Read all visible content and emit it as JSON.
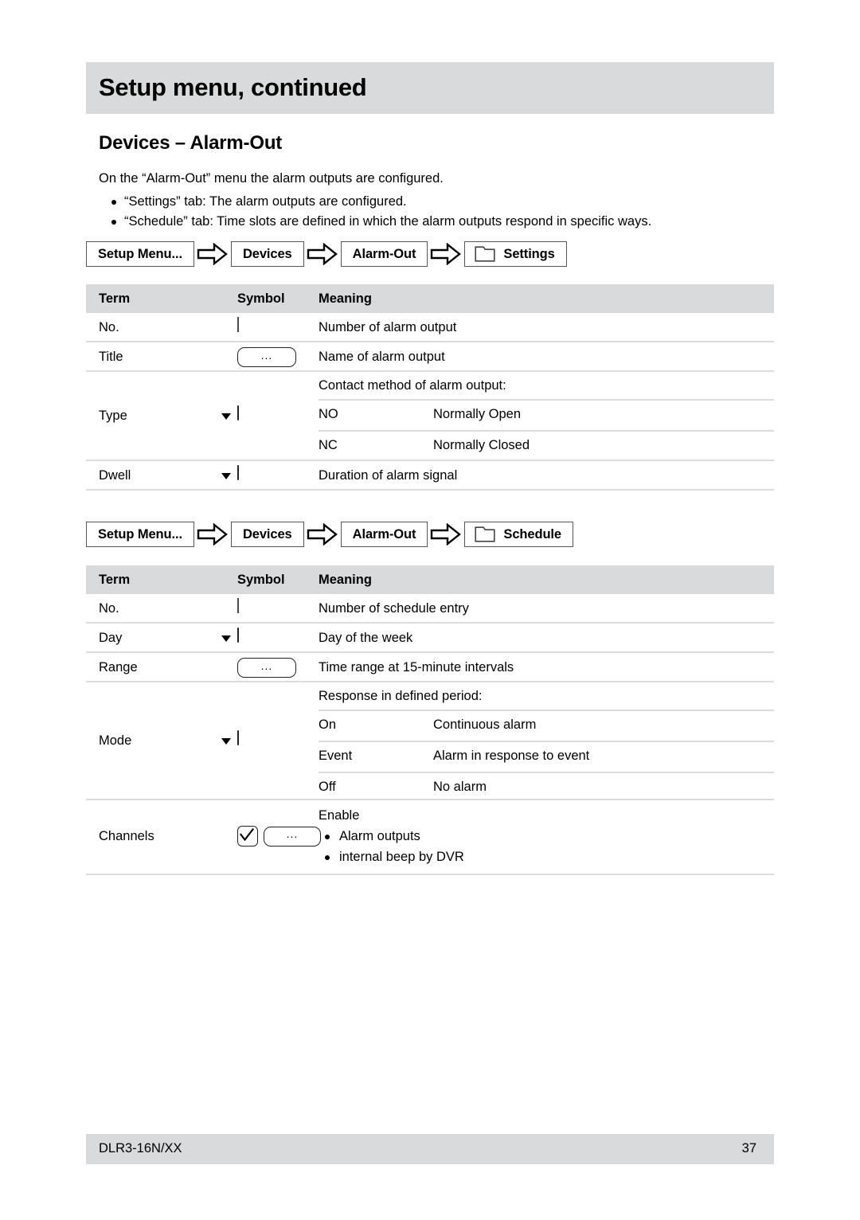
{
  "header": {
    "running_title": "Setup menu, continued"
  },
  "section": {
    "heading": "Devices – Alarm-Out",
    "intro": "On the “Alarm-Out” menu the alarm outputs are configured.",
    "bullets": [
      "“Settings” tab: The alarm outputs are configured.",
      "“Schedule” tab: Time slots are defined in which the alarm outputs respond in specific ways."
    ]
  },
  "breadcrumb_settings": {
    "crumbs": [
      "Setup Menu...",
      "Devices",
      "Alarm-Out",
      "Settings"
    ],
    "separator_icon": "right-block-arrow-icon",
    "tab_icon": "folder-tab-icon"
  },
  "breadcrumb_schedule": {
    "crumbs": [
      "Setup Menu...",
      "Devices",
      "Alarm-Out",
      "Schedule"
    ],
    "separator_icon": "right-block-arrow-icon",
    "tab_icon": "folder-tab-icon"
  },
  "table_settings": {
    "columns": [
      "Term",
      "Symbol",
      "Meaning"
    ],
    "rows": [
      {
        "term": "No.",
        "symbol": "text-input-box",
        "symbol_text": "",
        "meaning": "Number of alarm output"
      },
      {
        "term": "Title",
        "symbol": "ellipsis-button",
        "symbol_text": "...",
        "meaning": "Name of alarm output"
      },
      {
        "term": "Type",
        "symbol": "dropdown-select",
        "symbol_text": "",
        "sub_caption": "Contact method of alarm output:",
        "options": [
          {
            "key": "NO",
            "value": "Normally Open"
          },
          {
            "key": "NC",
            "value": "Normally Closed"
          }
        ]
      },
      {
        "term": "Dwell",
        "symbol": "dropdown-select",
        "symbol_text": "",
        "meaning": "Duration of alarm signal"
      }
    ]
  },
  "table_schedule": {
    "columns": [
      "Term",
      "Symbol",
      "Meaning"
    ],
    "rows": [
      {
        "term": "No.",
        "symbol": "text-input-box",
        "symbol_text": "",
        "meaning": "Number of schedule entry"
      },
      {
        "term": "Day",
        "symbol": "dropdown-select",
        "symbol_text": "",
        "meaning": "Day of the week"
      },
      {
        "term": "Range",
        "symbol": "ellipsis-button",
        "symbol_text": "...",
        "meaning": "Time range at 15-minute intervals"
      },
      {
        "term": "Mode",
        "symbol": "dropdown-select",
        "symbol_text": "",
        "sub_caption": "Response in defined period:",
        "options": [
          {
            "key": "On",
            "value": "Continuous alarm"
          },
          {
            "key": "Event",
            "value": "Alarm in response to event"
          },
          {
            "key": "Off",
            "value": "No alarm"
          }
        ]
      },
      {
        "term": "Channels",
        "symbol": "checkbox-plus-ellipsis-button",
        "symbol_text": "...",
        "enable_title": "Enable",
        "enable_items": [
          "Alarm outputs",
          "internal beep by DVR"
        ]
      }
    ]
  },
  "footer": {
    "model": "DLR3-16N/XX",
    "page_number": "37"
  },
  "colors": {
    "band_gray": "#d9dadb",
    "rule_gray": "#dcdcdc",
    "text": "#000000"
  }
}
